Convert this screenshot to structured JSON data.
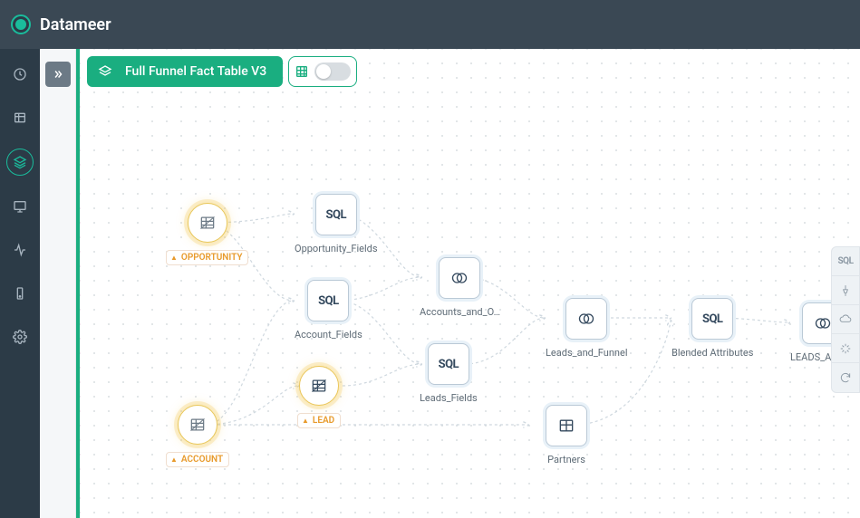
{
  "brand": "Datameer",
  "project": {
    "name": "Full Funnel Fact Table V3"
  },
  "nodes": {
    "opportunity_src": {
      "label": "OPPORTUNITY"
    },
    "account_src": {
      "label": "ACCOUNT"
    },
    "lead_src": {
      "label": "LEAD"
    },
    "opportunity_fields": {
      "label": "Opportunity_Fields",
      "type": "SQL"
    },
    "account_fields": {
      "label": "Account_Fields",
      "type": "SQL"
    },
    "leads_fields": {
      "label": "Leads_Fields",
      "type": "SQL"
    },
    "accounts_and_o": {
      "label": "Accounts_and_O…"
    },
    "leads_and_funnel": {
      "label": "Leads_and_Funnel"
    },
    "partners": {
      "label": "Partners"
    },
    "blended_attributes": {
      "label": "Blended Attributes",
      "type": "SQL"
    },
    "leads_and_final": {
      "label": "LEADS_AND_…"
    }
  },
  "right_tools": {
    "sql": "SQL"
  }
}
